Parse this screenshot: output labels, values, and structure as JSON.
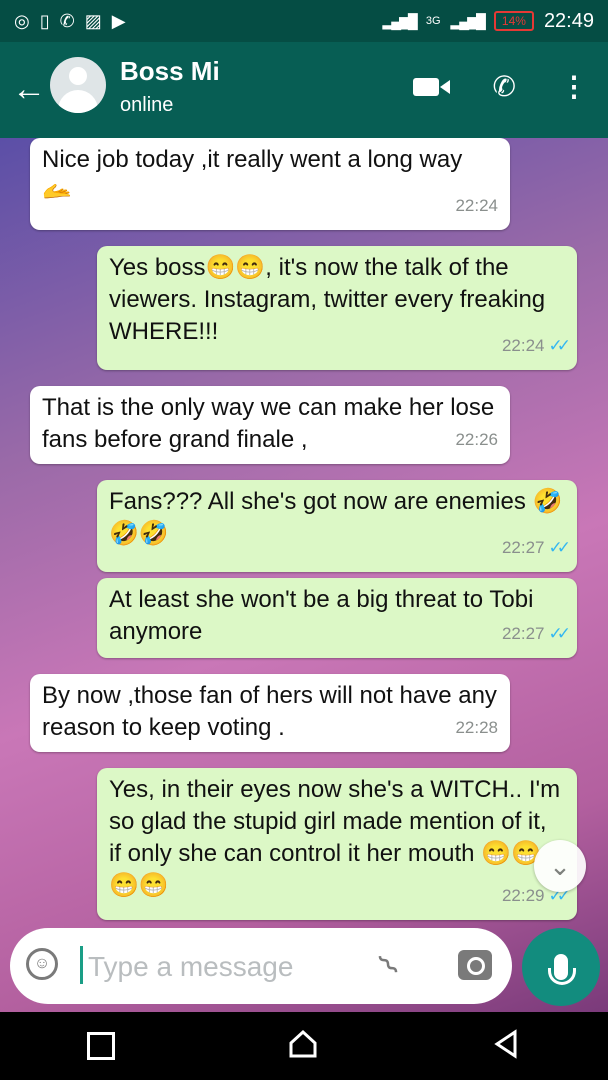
{
  "statusbar": {
    "time": "22:49",
    "battery": "14%",
    "network": "3G",
    "icons": [
      "instagram-icon",
      "phone-status-icon",
      "whatsapp-icon",
      "gallery-icon",
      "youtube-icon"
    ]
  },
  "header": {
    "back_icon": "back-arrow-icon",
    "contact_name": "Boss Mi",
    "contact_status": "online",
    "actions": [
      "video-call-icon",
      "voice-call-icon",
      "more-options-icon"
    ]
  },
  "messages": [
    {
      "dir": "in",
      "text": "Nice job today ,it really went a long way 🫴",
      "time": "22:24"
    },
    {
      "dir": "out",
      "text": "Yes boss😁😁, it's now the talk of the viewers.  Instagram, twitter every freaking WHERE!!!",
      "time": "22:24"
    },
    {
      "dir": "in",
      "text": "That is the only way we can make her lose fans before grand finale ,",
      "time": "22:26"
    },
    {
      "dir": "out",
      "text": "Fans??? All she's got now are enemies 🤣🤣🤣",
      "time": "22:27"
    },
    {
      "dir": "out",
      "text": "At least she won't be a big threat to Tobi anymore",
      "time": "22:27"
    },
    {
      "dir": "in",
      "text": "By now ,those fan of hers will not have any reason to keep voting .",
      "time": "22:28"
    },
    {
      "dir": "out",
      "text": "Yes,  in their eyes now she's a WITCH.. I'm so glad the stupid girl made mention of it, if only she can control it her mouth 😁😁😁😁",
      "time": "22:29"
    }
  ],
  "composer": {
    "placeholder": "Type a message"
  },
  "colors": {
    "header": "#075e54",
    "statusbar": "#054d44",
    "outgoing": "#dcf8c6",
    "incoming": "#ffffff",
    "tick": "#34b7f1",
    "mic": "#128c7e"
  }
}
